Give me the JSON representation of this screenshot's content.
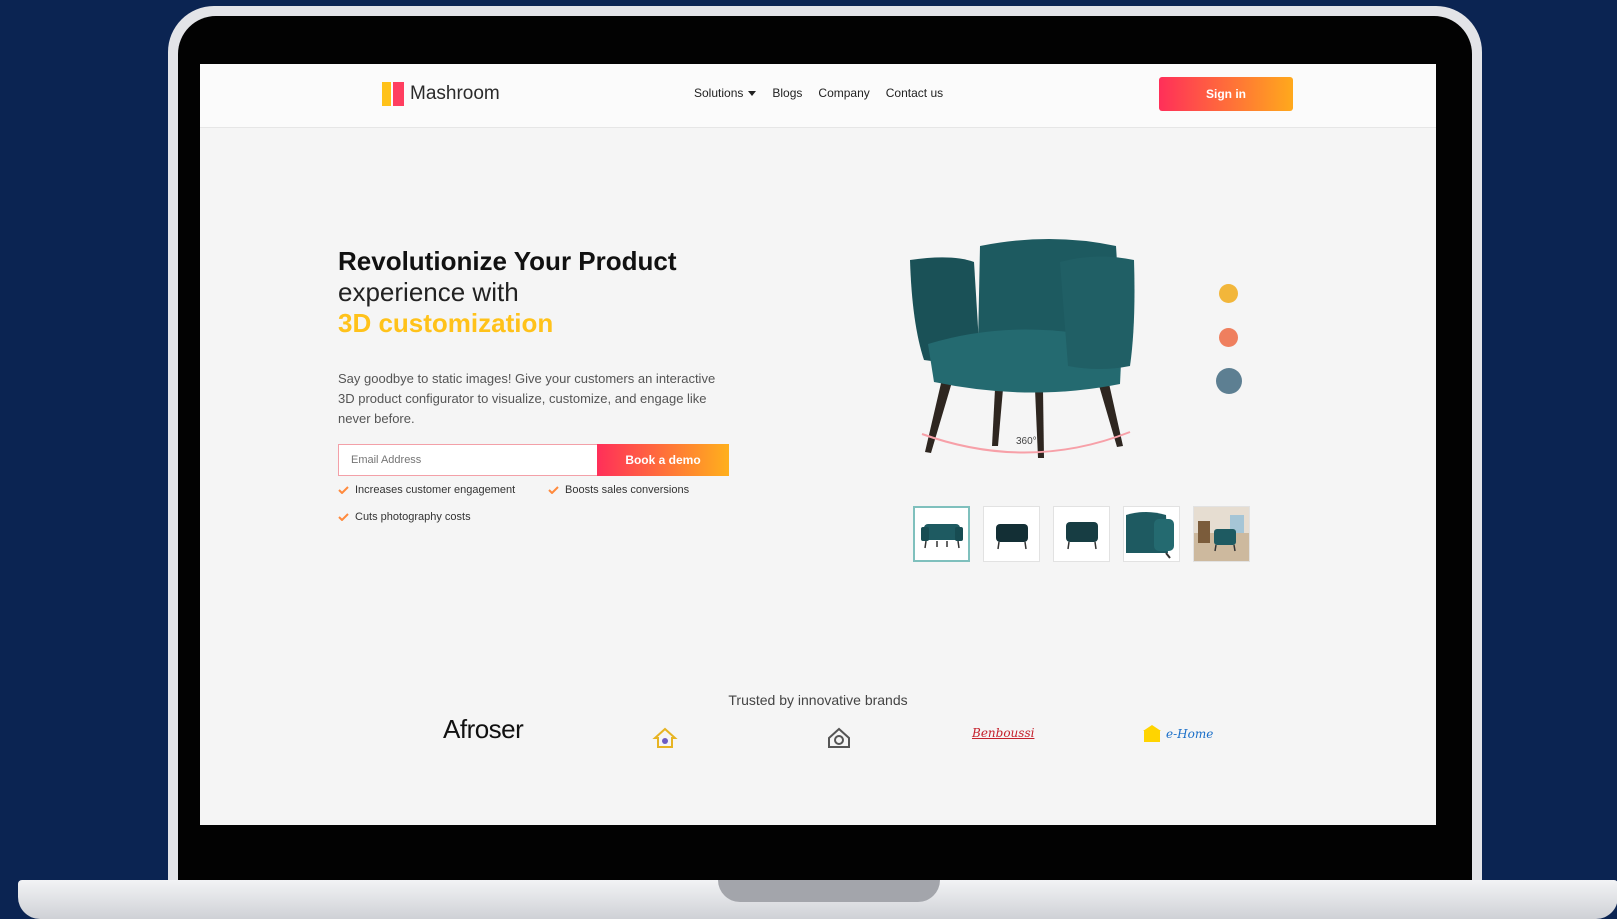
{
  "nav": {
    "logo_text": "Mashroom",
    "items": [
      "Solutions",
      "Blogs",
      "Company",
      "Contact us"
    ],
    "signin_label": "Sign in"
  },
  "hero": {
    "title_line1": "Revolutionize Your Product",
    "title_line2": "experience with",
    "title_line3": "3D customization",
    "description": "Say goodbye to static images! Give your customers an interactive 3D product configurator to visualize, customize, and engage like never before.",
    "email_placeholder": "Email Address",
    "book_label": "Book a demo",
    "features": [
      "Increases customer engagement",
      "Boosts sales conversions",
      "Cuts photography costs"
    ]
  },
  "viewer": {
    "rotate_label": "360°",
    "swatches": [
      "#f2b63a",
      "#ef7f5e",
      "#5d7f92"
    ]
  },
  "trusted": {
    "heading": "Trusted by innovative brands",
    "brand1": "Afroser",
    "brand4": "Benboussi",
    "brand5": "e-Home"
  },
  "colors": {
    "brand_yellow": "#ffc21a",
    "brand_red": "#ff2f59",
    "chair_teal": "#1e5a61"
  }
}
